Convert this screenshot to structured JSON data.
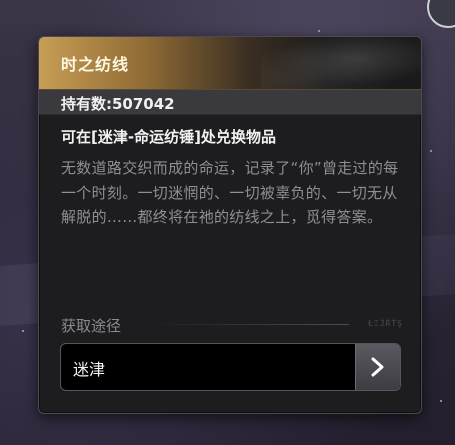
{
  "item": {
    "name": "时之纺线",
    "count_text": "持有数:507042",
    "exchange_text": "可在[迷津-命运纺锤]处兑换物品",
    "description": "无数道路交织而成的命运，记录了“你”曾走过的每一个时刻。一切迷惘的、一切被辜负的、一切无从解脱的……都终将在祂的纺线之上，觅得答案。"
  },
  "acquire": {
    "title": "获取途径",
    "tag_text": "ŁΞĴŘŤŞ",
    "sources": [
      {
        "label": "迷津"
      }
    ]
  },
  "icons": {
    "go": "chevron-right-icon",
    "close_corner": "circle-button-icon"
  },
  "colors": {
    "header_gold": "#c79e55",
    "panel_bg": "#1d1d20",
    "desc_text": "#8e8e93"
  }
}
